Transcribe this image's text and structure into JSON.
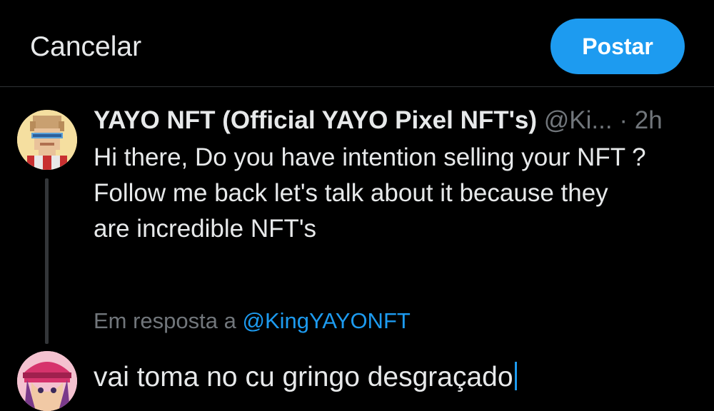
{
  "header": {
    "cancel_label": "Cancelar",
    "post_label": "Postar"
  },
  "tweet": {
    "author_name": "YAYO NFT (Official YAYO Pixel NFT's)",
    "handle": "@Ki...",
    "separator": "·",
    "time": "2h",
    "text_lines": [
      "Hi there, Do you have intention selling your NFT ?",
      "Follow me back let's talk about it because they",
      "are incredible NFT's"
    ]
  },
  "reply": {
    "prefix": "Em resposta a",
    "handle": "@KingYAYONFT"
  },
  "composer": {
    "text": "vai toma no cu gringo desgraçado"
  },
  "colors": {
    "background": "#000000",
    "accent": "#1d9bf0",
    "primary_text": "#e7e9ea",
    "secondary_text": "#71767b",
    "divider": "#2f3336"
  },
  "icons": {
    "avatar_1": "pixel-art-avatar",
    "avatar_2": "anime-avatar"
  }
}
